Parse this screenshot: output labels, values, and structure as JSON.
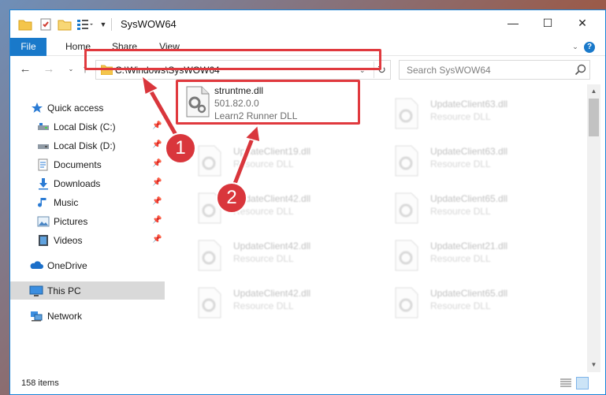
{
  "window": {
    "title": "SysWOW64",
    "controls": {
      "minimize": "—",
      "maximize": "☐",
      "close": "✕"
    }
  },
  "ribbon": {
    "tabs": [
      {
        "label": "File"
      },
      {
        "label": "Home"
      },
      {
        "label": "Share"
      },
      {
        "label": "View"
      }
    ],
    "help": "?"
  },
  "address": {
    "path": "C:\\Windows\\SysWOW64",
    "search_placeholder": "Search SysWOW64"
  },
  "nav": {
    "items": [
      {
        "label": "Quick access",
        "icon": "star-icon"
      },
      {
        "label": "Local Disk (C:)",
        "icon": "drive-icon",
        "pinned": true
      },
      {
        "label": "Local Disk (D:)",
        "icon": "drive-icon",
        "pinned": true
      },
      {
        "label": "Documents",
        "icon": "documents-icon",
        "pinned": true
      },
      {
        "label": "Downloads",
        "icon": "download-icon",
        "pinned": true
      },
      {
        "label": "Music",
        "icon": "music-icon",
        "pinned": true
      },
      {
        "label": "Pictures",
        "icon": "pictures-icon",
        "pinned": true
      },
      {
        "label": "Videos",
        "icon": "videos-icon",
        "pinned": true
      },
      {
        "label": "OneDrive",
        "icon": "cloud-icon"
      },
      {
        "label": "This PC",
        "icon": "computer-icon",
        "selected": true
      },
      {
        "label": "Network",
        "icon": "network-icon"
      }
    ]
  },
  "files": {
    "focused": {
      "name": "struntme.dll",
      "version": "501.82.0.0",
      "description": "Learn2 Runner DLL"
    },
    "tiles": [
      {
        "name": "UpdateClient63.dll",
        "type": "Resource DLL"
      },
      {
        "name": "UpdateClient19.dll",
        "type": "Resource DLL"
      },
      {
        "name": "UpdateClient63.dll",
        "type": "Resource DLL"
      },
      {
        "name": "UpdateClient42.dll",
        "type": "Resource DLL"
      },
      {
        "name": "UpdateClient65.dll",
        "type": "Resource DLL"
      },
      {
        "name": "UpdateClient42.dll",
        "type": "Resource DLL"
      },
      {
        "name": "UpdateClient21.dll",
        "type": "Resource DLL"
      },
      {
        "name": "UpdateClient42.dll",
        "type": "Resource DLL"
      },
      {
        "name": "UpdateClient65.dll",
        "type": "Resource DLL"
      }
    ]
  },
  "status": {
    "item_count": "158 items"
  },
  "callouts": {
    "first": "1",
    "second": "2"
  },
  "colors": {
    "accent": "#1979ca",
    "highlight": "#e0393e",
    "callout": "#d9363c"
  }
}
